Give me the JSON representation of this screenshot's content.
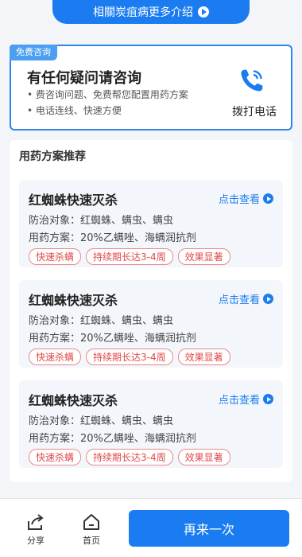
{
  "top_button": {
    "label": "相關炭疽病更多介绍"
  },
  "consult": {
    "tag": "免费咨询",
    "title": "有任何疑问请咨询",
    "bullet1": "• 费咨询问题、免费帮您配置用药方案",
    "bullet2": "• 电话连线、快速方便",
    "call_label": "拨打电话"
  },
  "section": {
    "title": "用药方案推荐"
  },
  "cards": [
    {
      "name": "红蜘蛛快速灭杀",
      "view": "点击查看",
      "target": "防治对象：红蜘蛛、螨虫、螨虫",
      "plan": "用药方案：20%乙螨唑、海螨润抗剂",
      "tags": [
        "快速杀螨",
        "持续期长达3-4周",
        "效果显著"
      ]
    },
    {
      "name": "红蜘蛛快速灭杀",
      "view": "点击查看",
      "target": "防治对象：红蜘蛛、螨虫、螨虫",
      "plan": "用药方案：20%乙螨唑、海螨润抗剂",
      "tags": [
        "快速杀螨",
        "持续期长达3-4周",
        "效果显著"
      ]
    },
    {
      "name": "红蜘蛛快速灭杀",
      "view": "点击查看",
      "target": "防治对象：红蜘蛛、螨虫、螨虫",
      "plan": "用药方案：20%乙螨唑、海螨润抗剂",
      "tags": [
        "快速杀螨",
        "持续期长达3-4周",
        "效果显著"
      ]
    }
  ],
  "bottom": {
    "share": "分享",
    "home": "首页",
    "again": "再来一次"
  }
}
